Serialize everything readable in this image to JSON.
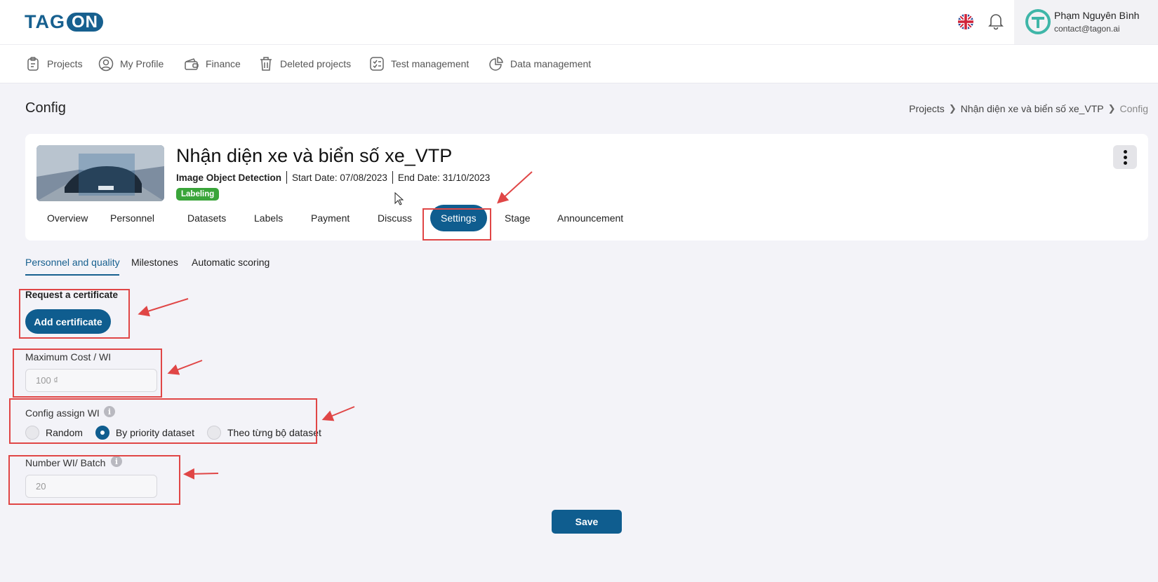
{
  "header": {
    "logo_text_left": "TAG",
    "logo_text_right": "ON",
    "language_icon": "uk-flag-icon",
    "notification_icon": "bell-icon",
    "user": {
      "name": "Phạm Nguyên Bình",
      "email": "contact@tagon.ai"
    }
  },
  "nav": {
    "items": [
      {
        "label": "Projects",
        "icon": "clipboard-icon"
      },
      {
        "label": "My Profile",
        "icon": "user-circle-icon"
      },
      {
        "label": "Finance",
        "icon": "wallet-icon"
      },
      {
        "label": "Deleted projects",
        "icon": "trash-icon"
      },
      {
        "label": "Test management",
        "icon": "checklist-icon"
      },
      {
        "label": "Data management",
        "icon": "pie-chart-icon"
      }
    ]
  },
  "page": {
    "title": "Config",
    "breadcrumb": [
      "Projects",
      "Nhận diện xe và biển số xe_VTP",
      "Config"
    ]
  },
  "project": {
    "title": "Nhận diện xe và biển số xe_VTP",
    "type": "Image Object Detection",
    "start_date": "Start Date: 07/08/2023",
    "end_date": "End Date: 31/10/2023",
    "status": "Labeling",
    "status_color": "#3aa53a",
    "tabs": [
      "Overview",
      "Personnel",
      "Datasets",
      "Labels",
      "Payment",
      "Discuss",
      "Settings",
      "Stage",
      "Announcement"
    ],
    "active_tab": "Settings"
  },
  "subtabs": {
    "items": [
      "Personnel and quality",
      "Milestones",
      "Automatic scoring"
    ],
    "active": "Personnel and quality"
  },
  "form": {
    "certificate_label": "Request a certificate",
    "add_certificate_button": "Add certificate",
    "max_cost_label": "Maximum Cost / WI",
    "max_cost_placeholder": "100 ₫",
    "assign_label": "Config assign WI",
    "assign_options": [
      "Random",
      "By priority dataset",
      "Theo từng bộ dataset"
    ],
    "assign_selected": "By priority dataset",
    "batch_label": "Number WI/ Batch",
    "batch_placeholder": "20",
    "save_button": "Save"
  },
  "theme": {
    "primary": "#0f5d8f",
    "annotation": "#e04646"
  }
}
